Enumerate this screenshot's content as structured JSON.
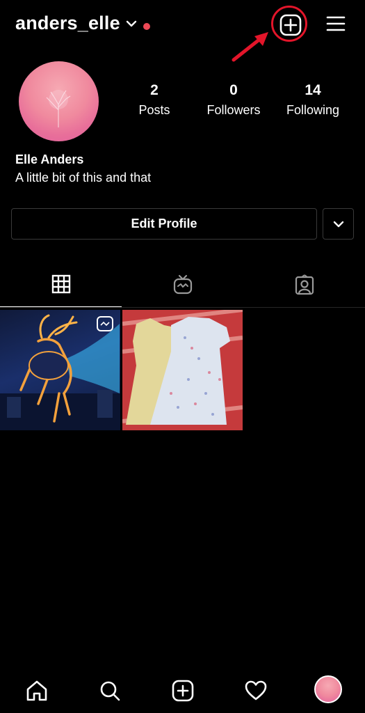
{
  "profile": {
    "username": "anders_elle",
    "display_name": "Elle Anders",
    "bio": "A little bit of this and that"
  },
  "stats": {
    "posts": {
      "value": "2",
      "label": "Posts"
    },
    "followers": {
      "value": "0",
      "label": "Followers"
    },
    "following": {
      "value": "14",
      "label": "Following"
    }
  },
  "buttons": {
    "edit_profile": "Edit Profile"
  },
  "tabs": [
    {
      "name": "grid",
      "icon": "grid-icon",
      "active": true
    },
    {
      "name": "igtv",
      "icon": "igtv-icon",
      "active": false
    },
    {
      "name": "tagged",
      "icon": "tagged-icon",
      "active": false
    }
  ],
  "posts": [
    {
      "subject": "glowing stag illustration",
      "badge": "igtv-icon"
    },
    {
      "subject": "two dresses on a striped bedspread",
      "badge": ""
    }
  ],
  "bottom_nav": [
    "home-icon",
    "search-icon",
    "add-post-icon",
    "heart-icon",
    "profile-avatar"
  ],
  "colors": {
    "background": "#000000",
    "text": "#ffffff",
    "notification_dot": "#ed4956",
    "annotation_red": "#e3152a",
    "border": "#3a3a3a"
  }
}
